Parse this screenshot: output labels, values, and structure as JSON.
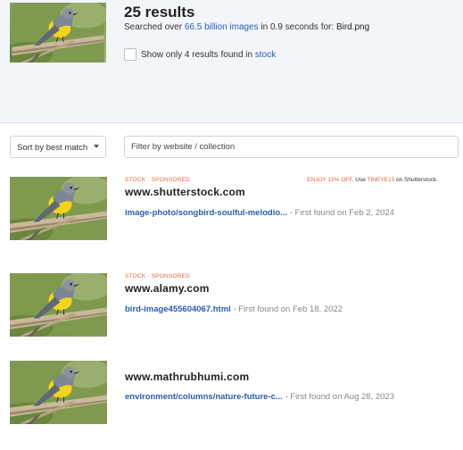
{
  "summary": {
    "title": "25 results",
    "searched_prefix": "Searched over ",
    "searched_count": "66.5 billion images",
    "searched_mid": " in 0.9 seconds for: ",
    "filename": "Bird.png",
    "stock_prefix": "Show only 4 results found in ",
    "stock_link": "stock"
  },
  "controls": {
    "sort_label": "Sort by best match",
    "filter_placeholder": "Filter by website / collection"
  },
  "results": [
    {
      "tags": "STOCK · SPONSORED",
      "promo_hot": "ENJOY 15% OFF.",
      "promo_mid": " Use ",
      "promo_code": "TINEYE15",
      "promo_end": " on Shutterstock.",
      "domain": "www.shutterstock.com",
      "path": "image-photo/songbird-soulful-melodio...",
      "found": " - First found on Feb 2, 2024"
    },
    {
      "tags": "STOCK · SPONSORED",
      "domain": "www.alamy.com",
      "path": "bird-image455604067.html",
      "found": " - First found on Feb 18, 2022"
    },
    {
      "domain": "www.mathrubhumi.com",
      "path": "environment/columns/nature-future-c...",
      "found": " - First found on Aug 28, 2023"
    }
  ],
  "colors": {
    "accent_link": "#2a5db0",
    "tag_orange": "#e8673a",
    "header_bg": "#f2f5fa"
  }
}
